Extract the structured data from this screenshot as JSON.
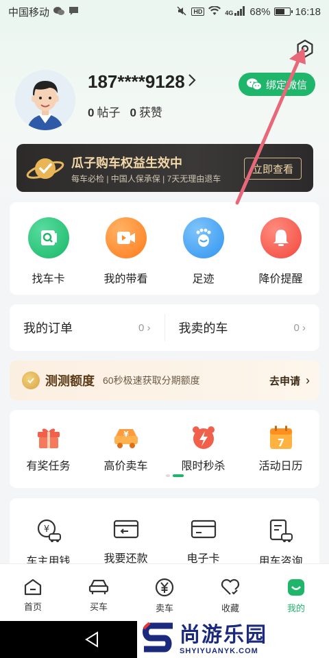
{
  "status_bar": {
    "carrier": "中国移动",
    "network": "4G",
    "battery": "68%",
    "battery_level": 0.68,
    "time": "16:18",
    "hd": "HD"
  },
  "profile": {
    "phone": "187****9128",
    "posts_count": "0",
    "posts_label": "帖子",
    "likes_count": "0",
    "likes_label": "获赞",
    "wechat_button": "绑定微信"
  },
  "banner": {
    "title": "瓜子购车权益生效中",
    "subtitle": "每车必检 | 中国人保承保 | 7天无理由退车",
    "button": "立即查看"
  },
  "quick_actions": [
    {
      "label": "找车卡",
      "icon": "find-car-card-icon",
      "color": "#24c47a"
    },
    {
      "label": "我的带看",
      "icon": "video-icon",
      "color": "#ff8a1f"
    },
    {
      "label": "足迹",
      "icon": "footprint-icon",
      "color": "#3ea3f5"
    },
    {
      "label": "降价提醒",
      "icon": "bell-icon",
      "color": "#f5584d"
    }
  ],
  "orders": {
    "my_orders": "我的订单",
    "my_orders_count": "0",
    "sold_cars": "我卖的车",
    "sold_cars_count": "0"
  },
  "quota": {
    "title": "测测额度",
    "desc": "60秒极速获取分期额度",
    "action": "去申请"
  },
  "tasks": [
    {
      "label": "有奖任务",
      "icon": "gift-icon"
    },
    {
      "label": "高价卖车",
      "icon": "sell-car-icon"
    },
    {
      "label": "限时秒杀",
      "icon": "flash-sale-icon"
    },
    {
      "label": "活动日历",
      "icon": "calendar-icon",
      "day": "7"
    }
  ],
  "services": [
    {
      "label": "车主用钱",
      "icon": "car-loan-icon"
    },
    {
      "label": "我要还款",
      "icon": "repay-card-icon"
    },
    {
      "label": "电子卡",
      "icon": "e-card-icon"
    },
    {
      "label": "用车咨询",
      "icon": "consult-icon"
    }
  ],
  "tabbar": [
    {
      "label": "首页",
      "icon": "home-icon",
      "active": false
    },
    {
      "label": "买车",
      "icon": "car-icon",
      "active": false
    },
    {
      "label": "卖车",
      "icon": "yuan-icon",
      "active": false
    },
    {
      "label": "收藏",
      "icon": "heart-icon",
      "active": false
    },
    {
      "label": "我的",
      "icon": "profile-icon",
      "active": true
    }
  ],
  "watermark": {
    "cn": "尚游乐园",
    "en": "SHYIYUANYK.COM"
  },
  "colors": {
    "brand_green": "#1fb56b",
    "banner_gold": "#f4d9a8",
    "arrow": "#e8687a"
  }
}
